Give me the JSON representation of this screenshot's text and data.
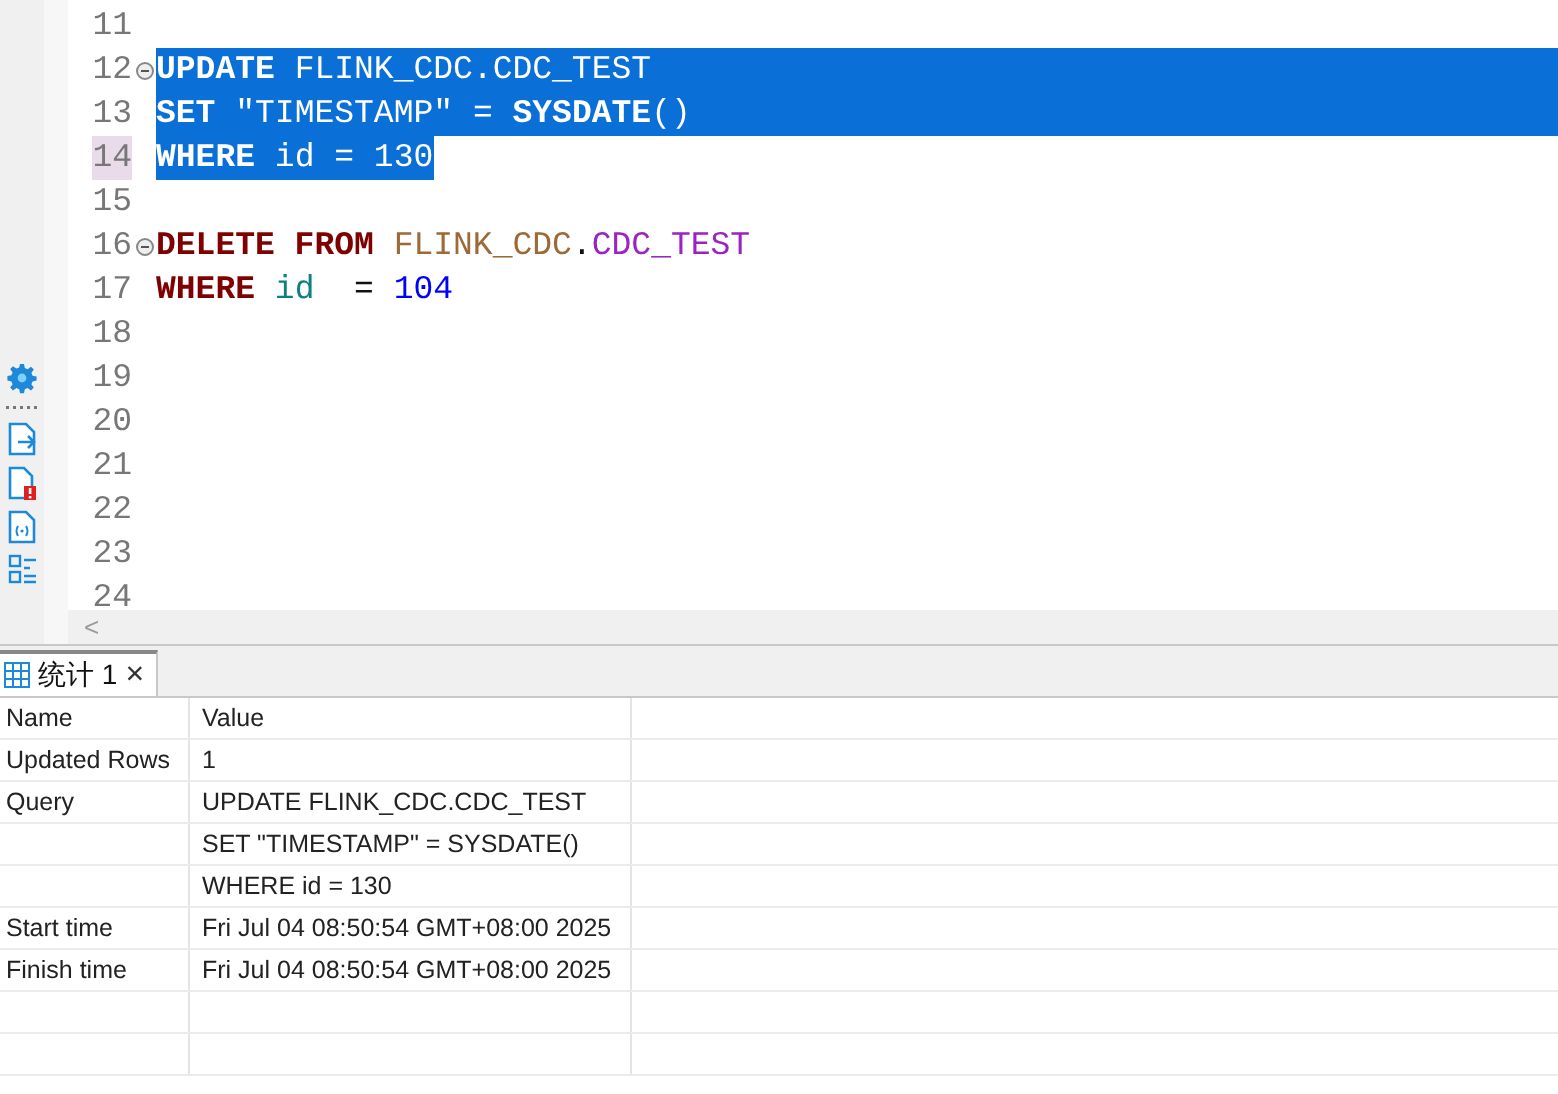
{
  "editor": {
    "lines": [
      {
        "number": "11",
        "selected": false
      },
      {
        "number": "12",
        "foldable": true,
        "selected": true,
        "full_width": true,
        "tokens": [
          {
            "kind": "keyword",
            "text": "UPDATE "
          },
          {
            "kind": "schema",
            "text": "FLINK_CDC.CDC_TEST"
          }
        ]
      },
      {
        "number": "13",
        "selected": true,
        "full_width": true,
        "tokens": [
          {
            "kind": "keyword",
            "text": "SET"
          },
          {
            "kind": "plain",
            "text": " \"TIMESTAMP\" = "
          },
          {
            "kind": "keyword",
            "text": "SYSDATE"
          },
          {
            "kind": "plain",
            "text": "()"
          }
        ]
      },
      {
        "number": "14",
        "current": true,
        "selected": true,
        "full_width": false,
        "tokens": [
          {
            "kind": "keyword",
            "text": "WHERE"
          },
          {
            "kind": "plain",
            "text": " id = 130"
          }
        ]
      },
      {
        "number": "15",
        "selected": false
      },
      {
        "number": "16",
        "foldable": true,
        "selected": false,
        "tokens": [
          {
            "kind": "keyword",
            "text": "DELETE FROM "
          },
          {
            "kind": "schema",
            "text": "FLINK_CDC"
          },
          {
            "kind": "plain",
            "text": "."
          },
          {
            "kind": "table",
            "text": "CDC_TEST"
          }
        ]
      },
      {
        "number": "17",
        "selected": false,
        "tokens": [
          {
            "kind": "keyword",
            "text": "WHERE "
          },
          {
            "kind": "column",
            "text": "id"
          },
          {
            "kind": "plain",
            "text": "  = "
          },
          {
            "kind": "number",
            "text": "104"
          }
        ]
      },
      {
        "number": "18",
        "selected": false
      },
      {
        "number": "19",
        "selected": false
      },
      {
        "number": "20",
        "selected": false
      },
      {
        "number": "21",
        "selected": false
      },
      {
        "number": "22",
        "selected": false
      },
      {
        "number": "23",
        "selected": false
      },
      {
        "number": "24",
        "selected": false
      }
    ],
    "scroll_left": "<"
  },
  "side_tools": [
    {
      "kind": "gear"
    },
    {
      "kind": "dots"
    },
    {
      "kind": "export"
    },
    {
      "kind": "error"
    },
    {
      "kind": "variable"
    },
    {
      "kind": "list"
    }
  ],
  "result_tab": {
    "label": "统计 1",
    "close": "×",
    "selected": true
  },
  "table": {
    "columns": [
      "Name",
      "Value"
    ],
    "rows": [
      {
        "name": "Updated Rows",
        "value": "1"
      },
      {
        "name": "Query",
        "value": "UPDATE FLINK_CDC.CDC_TEST"
      },
      {
        "value": "SET \"TIMESTAMP\" = SYSDATE()"
      },
      {
        "value": "WHERE id = 130"
      },
      {
        "name": "Start time",
        "value": "Fri Jul 04 08:50:54 GMT+08:00 2025"
      },
      {
        "name": "Finish time",
        "value": "Fri Jul 04 08:50:54 GMT+08:00 2025"
      }
    ]
  }
}
